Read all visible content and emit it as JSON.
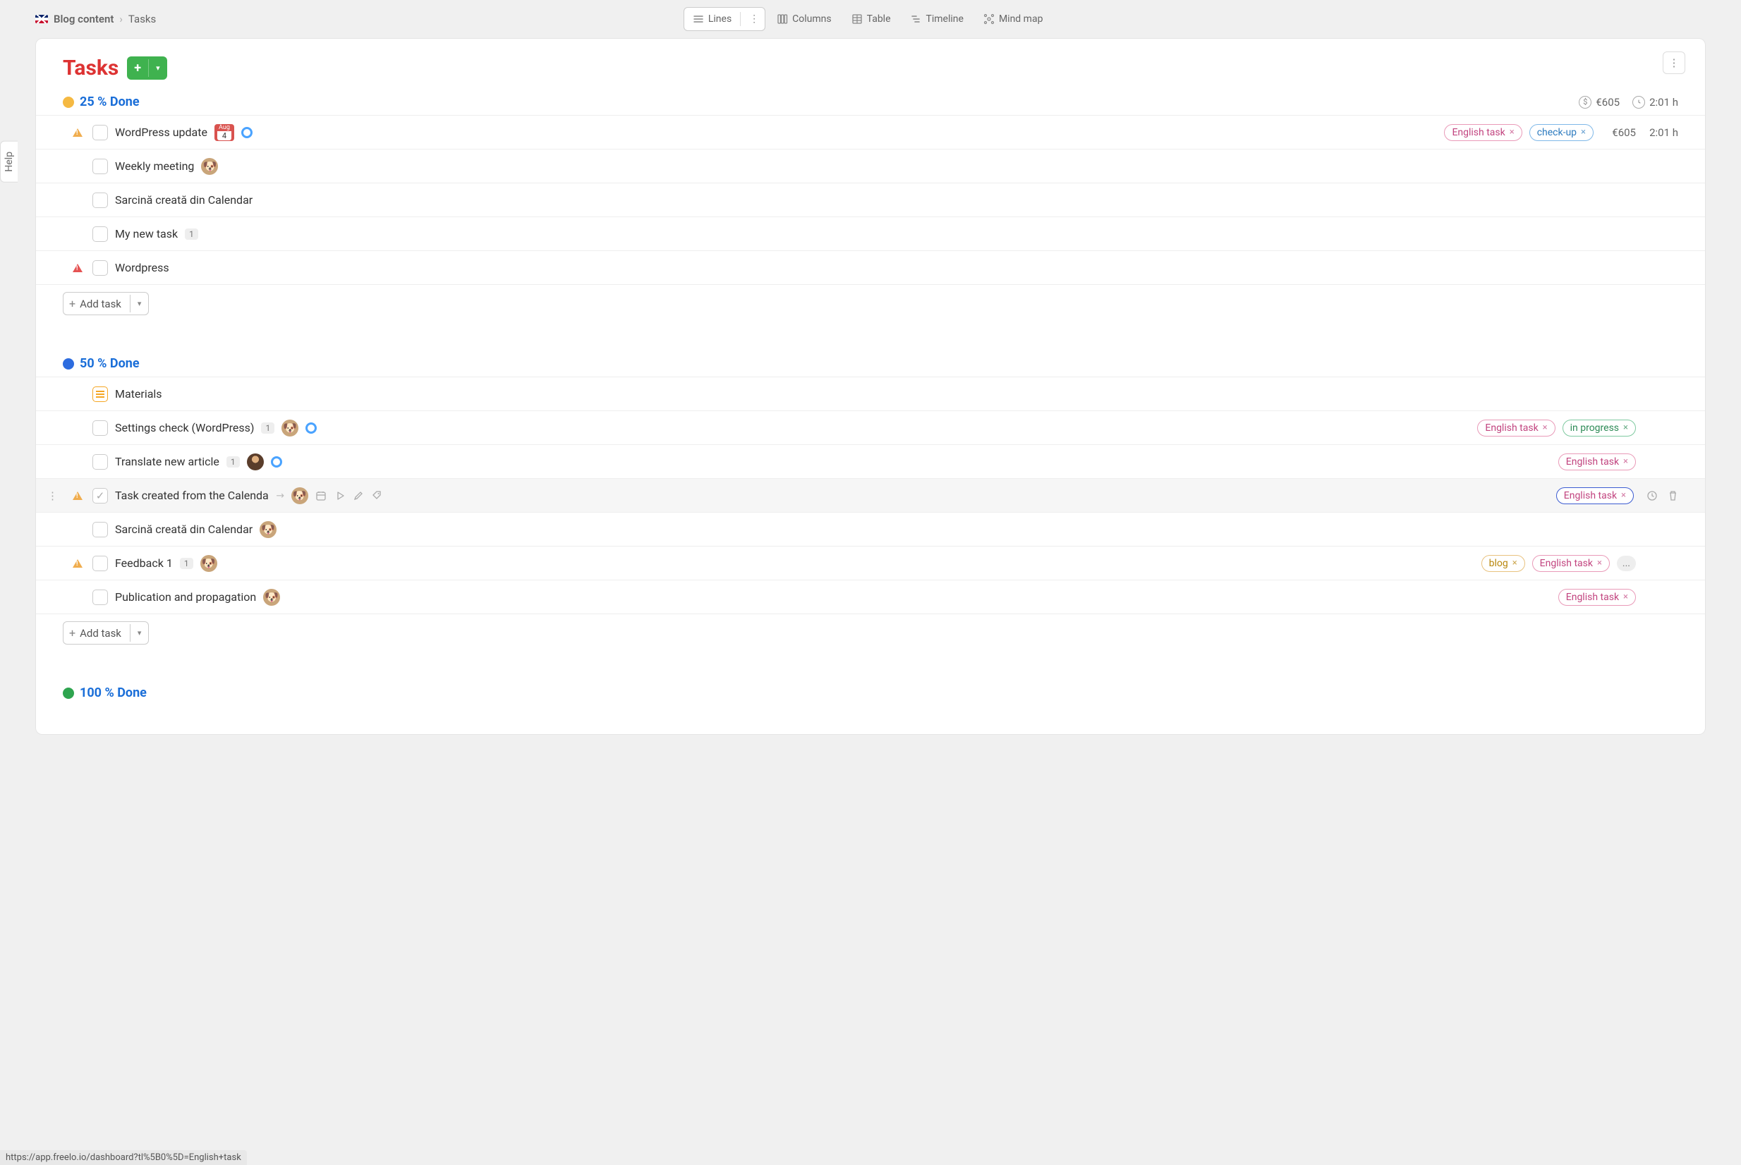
{
  "breadcrumb": {
    "project": "Blog content",
    "section": "Tasks"
  },
  "views": {
    "lines": "Lines",
    "columns": "Columns",
    "table": "Table",
    "timeline": "Timeline",
    "mindmap": "Mind map"
  },
  "help_label": "Help",
  "page_title": "Tasks",
  "groups": [
    {
      "title": "25 % Done",
      "dot": "y",
      "cost": "€605",
      "duration": "2:01 h",
      "tasks": [
        {
          "title": "WordPress update",
          "flag": "warn",
          "date": {
            "month": "Aug",
            "day": "4"
          },
          "status_circle": true,
          "tags": [
            {
              "label": "English task",
              "style": "pink"
            },
            {
              "label": "check-up",
              "style": "blue"
            }
          ],
          "cost": "€605",
          "duration": "2:01 h"
        },
        {
          "title": "Weekly meeting",
          "avatar": "dog"
        },
        {
          "title": "Sarcină creată din Calendar"
        },
        {
          "title": "My new task",
          "count": "1"
        },
        {
          "title": "Wordpress",
          "flag": "warn2"
        }
      ],
      "add_label": "Add task"
    },
    {
      "title": "50 % Done",
      "dot": "b",
      "tasks": [
        {
          "title": "Materials",
          "doc": true
        },
        {
          "title": "Settings check (WordPress)",
          "count": "1",
          "avatar": "dog",
          "status_circle": true,
          "tags": [
            {
              "label": "English task",
              "style": "pink"
            },
            {
              "label": "in progress",
              "style": "green"
            }
          ]
        },
        {
          "title": "Translate new article",
          "count": "1",
          "avatar": "person",
          "status_circle": true,
          "tags": [
            {
              "label": "English task",
              "style": "pink"
            }
          ]
        },
        {
          "title": "Task created from the Calenda",
          "hovered": true,
          "flag": "warn",
          "checked": true,
          "arrow": true,
          "avatar": "dog",
          "hover_actions": true,
          "tags": [
            {
              "label": "English task",
              "style": "pinkh"
            }
          ],
          "trail_actions": true
        },
        {
          "title": "Sarcină creată din Calendar",
          "avatar": "dog"
        },
        {
          "title": "Feedback 1",
          "flag": "warn",
          "count": "1",
          "avatar": "dog",
          "tags": [
            {
              "label": "blog",
              "style": "orange"
            },
            {
              "label": "English task",
              "style": "pink"
            },
            {
              "label": "...",
              "style": "more"
            }
          ]
        },
        {
          "title": "Publication and propagation",
          "avatar": "dog",
          "tags": [
            {
              "label": "English task",
              "style": "pink"
            }
          ]
        }
      ],
      "add_label": "Add task"
    },
    {
      "title": "100 % Done",
      "dot": "g"
    }
  ],
  "footer_url": "https://app.freelo.io/dashboard?tl%5B0%5D=English+task"
}
